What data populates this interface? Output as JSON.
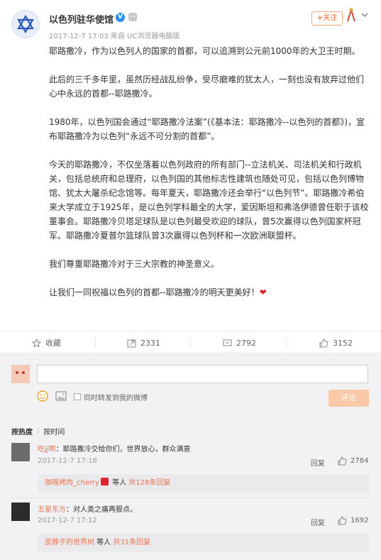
{
  "post": {
    "author": "以色列驻华使馆",
    "verified_badge": "V",
    "meta": "2017-12-7 17:03 来自 UC浏览器电脑版",
    "follow_label": "关注",
    "follow_plus": "+",
    "paragraphs": [
      "耶路撒冷，作为以色列人的国家的首都，可以追溯到公元前1000年的大卫王时期。",
      "此后的三千多年里，虽然历经战乱纷争，受尽磨难的犹太人，一刻也没有放弃过他们心中永远的首都--耶路撒冷。",
      "1980年，以色列国会通过“耶路撒冷法案”(《基本法：耶路撒冷--以色列的首都》)，宣布耶路撒冷为以色列“永远不可分割的首都”。",
      "今天的耶路撒冷，不仅坐落着以色列政府的所有部门--立法机关、司法机关和行政机关，包括总统府和总理府，以色列国的其他标志性建筑也随处可见，包括以色列博物馆、犹太大屠杀纪念馆等。每年夏天，耶路撒冷还会举行“以色列节”。耶路撒冷希伯来大学成立于1925年，是以色列学科最全的大学，爱因斯坦和弗洛伊德曾任职于该校董事会。耶路撒冷贝塔足球队是以色列最受欢迎的球队，曾5次赢得以色列国家杯冠军。耶路撒冷夏普尔篮球队曾3次赢得以色列杯和一次欧洲联盟杯。",
      "我们尊重耶路撒冷对于三大宗教的神圣意义。",
      "让我们一同祝福以色列的首都--耶路撒冷的明天更美好！"
    ],
    "heart": "❤"
  },
  "actions": {
    "favorite": "收藏",
    "forward_count": "2331",
    "comment_count": "2792",
    "like_count": "3152"
  },
  "composer": {
    "input_value": "",
    "repost_label": "同时转发到我的微博",
    "submit_label": "评论"
  },
  "sort": {
    "hot": "按热度",
    "time": "按时间"
  },
  "comments": [
    {
      "name": "吃jj啊",
      "text": "：耶路撒冷交给你们，世界放心，群众满意",
      "time": "2017-12-7 17:18",
      "reply": "回复",
      "likes": "2784",
      "sub_name": "咖喱烤肉_cherry",
      "sub_mid": " 等人 ",
      "sub_count": "共128条回复"
    },
    {
      "name": "五星东方",
      "text": "：对人类之痛再狠点。",
      "time": "2017-12-7 17:12",
      "reply": "回复",
      "likes": "1692",
      "sub_name": "歪脖子的世界树",
      "sub_mid": " 等人 ",
      "sub_count": "共31条回复"
    }
  ],
  "colors": {
    "accent": "#eb7350",
    "follow_border": "#f5a37a",
    "submit_bg": "#fbc9a7",
    "verified": "#2d8ee6"
  }
}
